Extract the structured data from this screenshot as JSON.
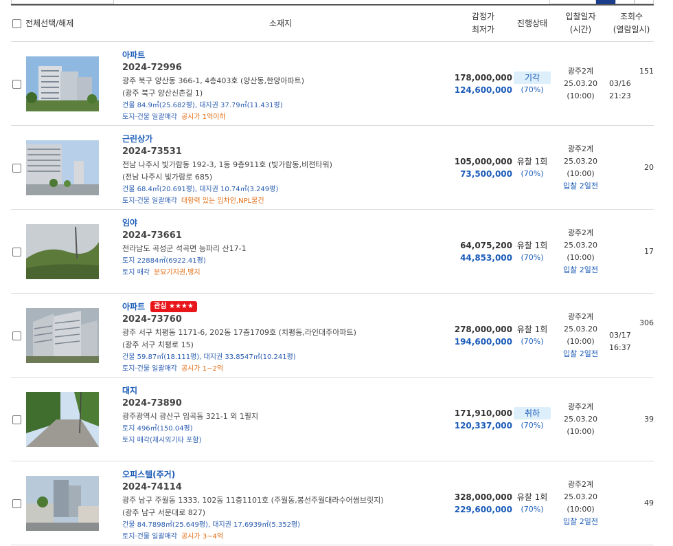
{
  "header": {
    "select_all": "전체선택/해제",
    "location": "소재지",
    "price_line1": "감정가",
    "price_line2": "최저가",
    "status": "진행상태",
    "date_line1": "입찰일자",
    "date_line2": "(시간)",
    "views_line1": "조회수",
    "views_line2": "(열람일시)"
  },
  "rows": [
    {
      "type": "아파트",
      "badge": "",
      "case": "2024-72996",
      "addr1": "광주 북구 양산동 366-1, 4층403호 (양산동,한양아파트)",
      "addr2": "(광주 북구 양산신촌길 1)",
      "area": "건물 84.9㎡(25.682평), 대지권 37.79㎡(11.431평)",
      "kind": "토지·건물 일괄매각",
      "note": "공시가 1억이하",
      "appraisal": "178,000,000",
      "minimum": "124,600,000",
      "status": "기각",
      "pct": "(70%)",
      "court": "광주2계",
      "date": "25.03.20",
      "time": "(10:00)",
      "dday": "",
      "views": "151",
      "viewed_at": "03/16 21:23"
    },
    {
      "type": "근린상가",
      "badge": "",
      "case": "2024-73531",
      "addr1": "전남 나주시 빛가람동 192-3, 1동 9층911호 (빛가람동,비젼타워)",
      "addr2": "(전남 나주시 빛가람로 685)",
      "area": "건물 68.4㎡(20.691평), 대지권 10.74㎡(3.249평)",
      "kind": "토지·건물 일괄매각",
      "note": "대항력 있는 임차인,NPL물건",
      "appraisal": "105,000,000",
      "minimum": "73,500,000",
      "status": "유찰 1회",
      "pct": "(70%)",
      "court": "광주2계",
      "date": "25.03.20",
      "time": "(10:00)",
      "dday": "입찰 2일전",
      "views": "20",
      "viewed_at": ""
    },
    {
      "type": "임야",
      "badge": "",
      "case": "2024-73661",
      "addr1": "전라남도 곡성군 석곡면 능파리 산17-1",
      "addr2": "",
      "area": "토지 22884㎡(6922.41평)",
      "kind": "토지 매각",
      "note": "분묘기지권,맹지",
      "appraisal": "64,075,200",
      "minimum": "44,853,000",
      "status": "유찰 1회",
      "pct": "(70%)",
      "court": "광주2계",
      "date": "25.03.20",
      "time": "(10:00)",
      "dday": "입찰 2일전",
      "views": "17",
      "viewed_at": ""
    },
    {
      "type": "아파트",
      "badge": "관심 ★★★★",
      "case": "2024-73760",
      "addr1": "광주 서구 치평동 1171-6, 202동 17층1709호 (치평동,라인대주아파트)",
      "addr2": "(광주 서구 치평로 15)",
      "area": "건물 59.87㎡(18.111평), 대지권 33.8547㎡(10.241평)",
      "kind": "토지·건물 일괄매각",
      "note": "공시가 1~2억",
      "appraisal": "278,000,000",
      "minimum": "194,600,000",
      "status": "유찰 1회",
      "pct": "(70%)",
      "court": "광주2계",
      "date": "25.03.20",
      "time": "(10:00)",
      "dday": "입찰 2일전",
      "views": "306",
      "viewed_at": "03/17 16:37"
    },
    {
      "type": "대지",
      "badge": "",
      "case": "2024-73890",
      "addr1": "광주광역시 광산구 임곡동 321-1 외 1필지",
      "addr2": "",
      "area": "토지 496㎡(150.04평)",
      "kind": "토지 매각(제시외기타 포함)",
      "note": "",
      "appraisal": "171,910,000",
      "minimum": "120,337,000",
      "status": "취하",
      "pct": "(70%)",
      "court": "광주2계",
      "date": "25.03.20",
      "time": "(10:00)",
      "dday": "",
      "views": "39",
      "viewed_at": ""
    },
    {
      "type": "오피스텔(주거)",
      "badge": "",
      "case": "2024-74114",
      "addr1": "광주 남구 주월동 1333, 102동 11층1101호 (주월동,봉선주월대라수어썸브릿지)",
      "addr2": "(광주 남구 서문대로 827)",
      "area": "건물 84.7898㎡(25.649평), 대지권 17.6939㎡(5.352평)",
      "kind": "토지·건물 일괄매각",
      "note": "공시가 3~4억",
      "appraisal": "328,000,000",
      "minimum": "229,600,000",
      "status": "유찰 1회",
      "pct": "(70%)",
      "court": "광주2계",
      "date": "25.03.20",
      "time": "(10:00)",
      "dday": "입찰 2일전",
      "views": "49",
      "viewed_at": ""
    }
  ],
  "colors": {
    "accent": "#1a5bb8",
    "note": "#e06a10",
    "badge": "#e8151b",
    "status_highlight": "#dceffb"
  }
}
